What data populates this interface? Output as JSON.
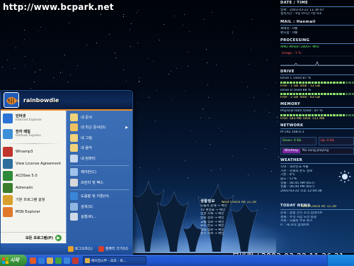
{
  "desktop": {
    "watermark": "http://www.bcpark.net",
    "clock": "봄바람 / 2003-03-22 11:36:31"
  },
  "monitor": {
    "date_time": {
      "header": "DATE / TIME",
      "rows": [
        "날짜 : 2003-03-22    11:36:07",
        "접속시간 : 0일 0시간 7분 0초"
      ]
    },
    "mail": {
      "header": "MAIL : Hanmail",
      "rows": [
        "새메일 : 0통",
        "편지함 : 0통"
      ]
    },
    "processing": {
      "header": "PROCESSING",
      "rows": [
        "AMD Athlon  1800+ Mhz"
      ],
      "cpu_label": "Usage : 1 %"
    },
    "drive": {
      "header": "DRIVE",
      "rows": [
        "Drive C Used 87 %",
        "Free : 1 GB     Total : 12 GB",
        "Drive D Used 88 %",
        "Free : 2 GB     Total : 63 GB"
      ],
      "used_fraction": [
        0.87,
        0.88
      ]
    },
    "memory": {
      "header": "MEMORY",
      "rows": [
        "Physical Ram Used : 87 %",
        "Free: 583 Mb          Total: 511 MB"
      ],
      "used_fraction": 0.87
    },
    "network": {
      "header": "NETWORK",
      "rows": [
        "IP:192.168.0.3"
      ],
      "down": "Down: 0 Kb",
      "up": "Up: 0 Kb"
    },
    "song": {
      "tag": "WinAmp",
      "text": "No song playing"
    },
    "weather": {
      "header": "WEATHER",
      "rows": [
        "지역 : 대한민국 서울",
        "기온 : 현재의 온도 정보",
        "기온 : 8℃",
        "습도 : 57%",
        "일출 : 06:45 AM (KST)",
        "일몰 : 06:49 PM (KST)",
        "2003-03-22 오후 12:04:38"
      ]
    },
    "news": {
      "header": "TODAY NEWS",
      "next_check": "Next Check At: 11:39",
      "rows": [
        "문화 : 봄철 전시 소식 업데이트",
        "경제 : 주식 시장 오전 동향",
        "사회 : 오늘의 주요 뉴스",
        "IT : 새 소식 업데이트"
      ]
    }
  },
  "schedule": {
    "header": "생활정보",
    "next_check": "Next Check At: 11:39",
    "rows": [
      "오늘의 운세 → 확인",
      "TV 편성표 → 확인",
      "증권 시세 → 확인",
      "날씨 정보 → 확인",
      "교통 정보 → 확인",
      "로또 번호 → 확인",
      "영화 정보 → 확인",
      "뉴스 속보 → 확인"
    ]
  },
  "start_menu": {
    "user": "rainbowdie",
    "pinned": [
      {
        "title": "인터넷",
        "sub": "Internet Explorer",
        "icon": "ie-icon",
        "color": "#2b74d6"
      },
      {
        "title": "전자 메일",
        "sub": "Outlook Express",
        "icon": "mail-icon",
        "color": "#3d8fd8"
      }
    ],
    "recent": [
      {
        "label": "Winamp3",
        "icon": "winamp-icon",
        "color": "#c0352e"
      },
      {
        "label": "View License Agreement",
        "icon": "license-icon",
        "color": "#2d6f9c"
      },
      {
        "label": "ACDSee 5.0",
        "icon": "acdsee-icon",
        "color": "#2f8a3a"
      },
      {
        "label": "Adrenalin",
        "icon": "adrenalin-icon",
        "color": "#3b7d2c"
      },
      {
        "label": "기본 프로그램 설정",
        "icon": "defaults-icon",
        "color": "#d8a02a"
      },
      {
        "label": "MSN Explorer",
        "icon": "msn-icon",
        "color": "#e0792a"
      }
    ],
    "all_programs": "모든 프로그램(P)",
    "right": [
      {
        "label": "내 문서",
        "icon": "documents-icon",
        "color": "#f0d27a",
        "arrow": false
      },
      {
        "label": "내 최근 문서(D)",
        "icon": "recent-docs-icon",
        "color": "#f0c060",
        "arrow": true
      },
      {
        "label": "내 그림",
        "icon": "pictures-icon",
        "color": "#f0d27a",
        "arrow": false
      },
      {
        "label": "내 음악",
        "icon": "music-icon",
        "color": "#f0d27a",
        "arrow": false
      },
      {
        "label": "내 컴퓨터",
        "icon": "computer-icon",
        "color": "#c7d7ee",
        "arrow": false
      },
      {
        "label": "제어판(C)",
        "icon": "control-panel-icon",
        "color": "#9fc2ea",
        "arrow": false
      },
      {
        "label": "프린터 및 팩스",
        "icon": "printer-icon",
        "color": "#d9d9d9",
        "arrow": false
      },
      {
        "label": "도움말 및 지원(H)",
        "icon": "help-icon",
        "color": "#3a86d8",
        "arrow": false
      },
      {
        "label": "검색(S)",
        "icon": "search-icon",
        "color": "#8fb6e2",
        "arrow": false
      },
      {
        "label": "실행(R)...",
        "icon": "run-icon",
        "color": "#cfd9e8",
        "arrow": false
      }
    ],
    "footer": {
      "logoff": "로그오프(L)",
      "shutdown": "컴퓨터 끄기(U)"
    }
  },
  "taskbar": {
    "start_label": "시작",
    "task": "에이전스무 - 오조 - 트..."
  }
}
